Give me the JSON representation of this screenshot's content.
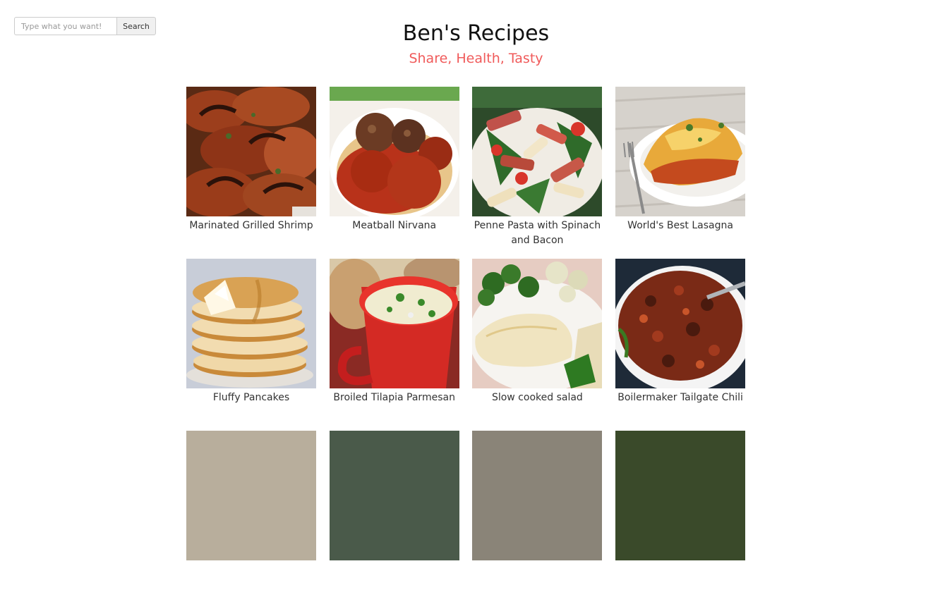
{
  "search": {
    "placeholder": "Type what you want!",
    "button_label": "Search"
  },
  "header": {
    "title": "Ben's Recipes",
    "tagline": "Share, Health, Tasty"
  },
  "colors": {
    "tagline": "#f05a5a"
  },
  "recipes": [
    {
      "title": "Marinated Grilled Shrimp"
    },
    {
      "title": "Meatball Nirvana"
    },
    {
      "title": "Penne Pasta with Spinach and Bacon"
    },
    {
      "title": "World's Best Lasagna"
    },
    {
      "title": "Fluffy Pancakes"
    },
    {
      "title": "Broiled Tilapia Parmesan"
    },
    {
      "title": "Slow cooked salad"
    },
    {
      "title": "Boilermaker Tailgate Chili"
    }
  ]
}
